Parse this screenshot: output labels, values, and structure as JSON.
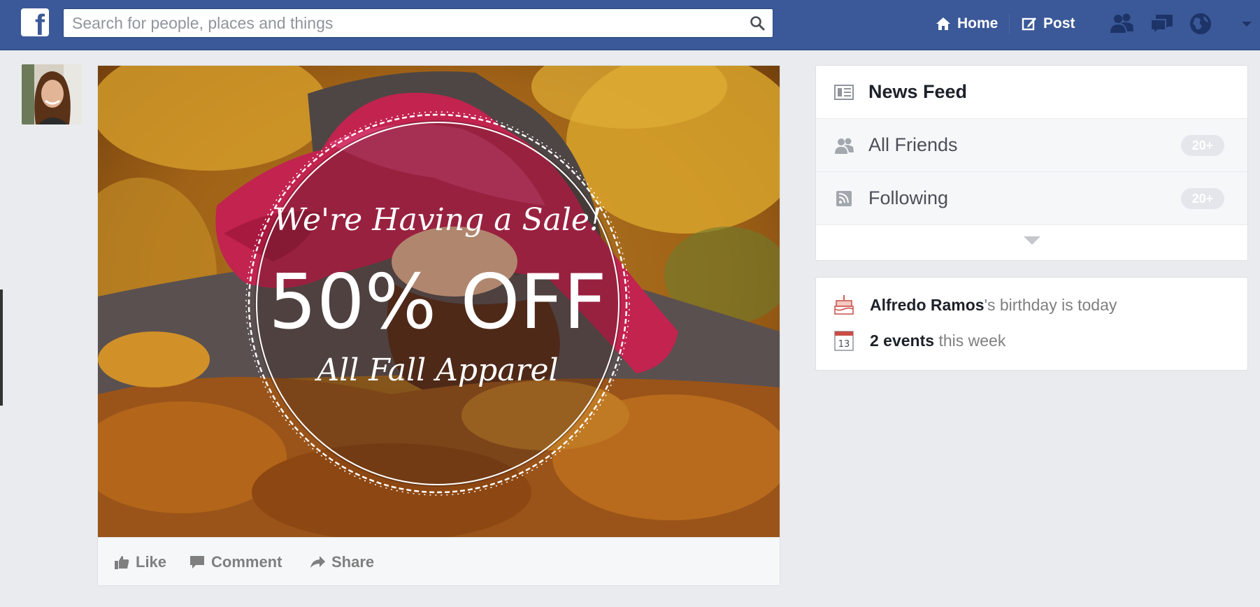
{
  "colors": {
    "brand": "#3b5998",
    "page_bg": "#e9ebee",
    "badge": "#e4e6eb"
  },
  "topbar": {
    "logo_glyph": "f",
    "search_placeholder": "Search for people, places and things",
    "home_label": "Home",
    "post_label": "Post",
    "icons": [
      "friend-requests-icon",
      "messages-icon",
      "notifications-globe-icon",
      "account-menu-caret-icon"
    ]
  },
  "post": {
    "sale": {
      "headline": "We're Having a Sale!",
      "offer": "50% OFF",
      "subline": "All Fall Apparel"
    },
    "actions": {
      "like": "Like",
      "comment": "Comment",
      "share": "Share"
    }
  },
  "sidebar": {
    "news_feed": "News Feed",
    "items": [
      {
        "label": "All Friends",
        "badge": "20+",
        "icon": "friends-icon"
      },
      {
        "label": "Following",
        "badge": "20+",
        "icon": "rss-icon"
      }
    ]
  },
  "events": {
    "birthday_name": "Alfredo Ramos",
    "birthday_text": "'s birthday is today",
    "events_count": "2 events",
    "events_text": " this week",
    "calendar_day": "13"
  }
}
